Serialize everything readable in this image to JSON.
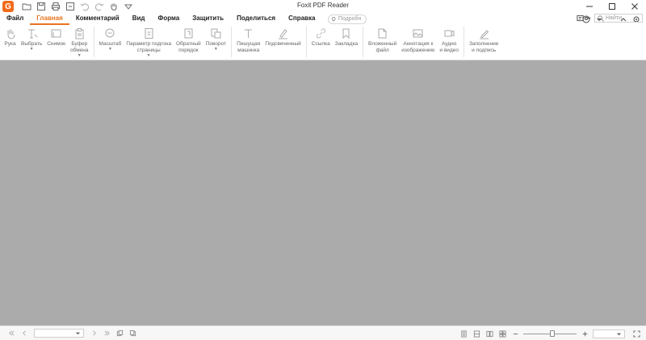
{
  "window": {
    "title": "Foxit PDF Reader"
  },
  "quick_access": {
    "icons": [
      "logo",
      "open-icon",
      "save-icon",
      "print-icon",
      "page-setup-icon",
      "undo-icon",
      "redo-icon",
      "hand-tool-icon",
      "customize-icon"
    ]
  },
  "menu": {
    "items": [
      {
        "label": "Файл",
        "active": false
      },
      {
        "label": "Главная",
        "active": true
      },
      {
        "label": "Комментарий",
        "active": false
      },
      {
        "label": "Вид",
        "active": false
      },
      {
        "label": "Форма",
        "active": false
      },
      {
        "label": "Защитить",
        "active": false
      },
      {
        "label": "Поделиться",
        "active": false
      },
      {
        "label": "Справка",
        "active": false
      }
    ],
    "tell_me": "Подробн",
    "search_placeholder": "Найти"
  },
  "ribbon": {
    "groups": [
      [
        {
          "label": "Рука",
          "icon": "hand-icon"
        },
        {
          "label": "Выбрать",
          "icon": "select-text-icon",
          "caret": true
        },
        {
          "label": "Снимок",
          "icon": "snapshot-icon"
        },
        {
          "label": "Буфер\nобмена",
          "icon": "clipboard-icon",
          "caret": true
        }
      ],
      [
        {
          "label": "Масштаб",
          "icon": "zoom-icon",
          "caret": true
        },
        {
          "label": "Параметр подгона\nстраницы",
          "icon": "fit-page-icon",
          "caret": true
        },
        {
          "label": "Обратный\nпорядок",
          "icon": "reverse-order-icon"
        },
        {
          "label": "Поворот",
          "icon": "rotate-icon",
          "caret": true
        }
      ],
      [
        {
          "label": "Пишущая\nмашинка",
          "icon": "typewriter-icon"
        },
        {
          "label": "Подсвеченный",
          "icon": "highlight-icon"
        }
      ],
      [
        {
          "label": "Ссылка",
          "icon": "link-icon"
        },
        {
          "label": "Закладка",
          "icon": "bookmark-icon"
        }
      ],
      [
        {
          "label": "Вложенный\nфайл",
          "icon": "attachment-icon"
        },
        {
          "label": "Аннотация к\nизображению",
          "icon": "image-annotation-icon"
        },
        {
          "label": "Аудио\nи видео",
          "icon": "audio-video-icon"
        }
      ],
      [
        {
          "label": "Заполнение\nи подпись",
          "icon": "fill-sign-icon"
        }
      ]
    ]
  },
  "statusbar": {
    "page_value": "",
    "zoom_value": "",
    "zoom_level": 0.55
  },
  "colors": {
    "accent": "#e8731e",
    "document_background": "#ababab"
  }
}
